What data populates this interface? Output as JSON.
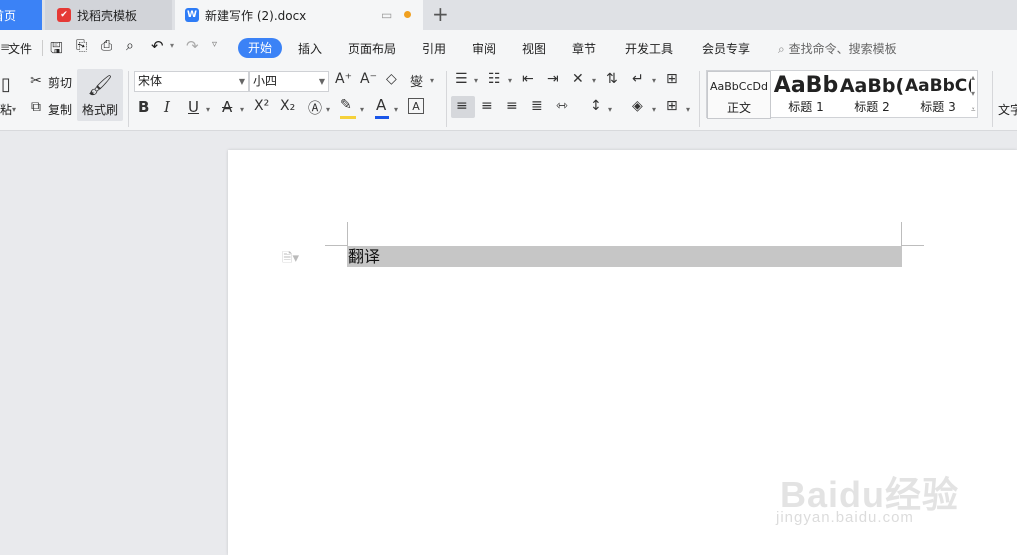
{
  "tabs": {
    "home": "首页",
    "template": "找稻壳模板",
    "document": "新建写作 (2).docx",
    "new_tab_icon": "plus-icon"
  },
  "menu": {
    "file": "文件",
    "items": [
      "开始",
      "插入",
      "页面布局",
      "引用",
      "审阅",
      "视图",
      "章节",
      "开发工具",
      "会员专享"
    ],
    "active": "开始",
    "search_placeholder": "查找命令、搜索模板"
  },
  "ribbon": {
    "clipboard": {
      "paste": "粘",
      "cut": "剪切",
      "copy": "复制",
      "format_painter": "格式刷"
    },
    "font": {
      "name": "宋体",
      "size": "小四"
    },
    "styles": [
      {
        "preview": "AaBbCcDd",
        "name": "正文"
      },
      {
        "preview": "AaBb",
        "name": "标题 1"
      },
      {
        "preview": "AaBb(",
        "name": "标题 2"
      },
      {
        "preview": "AaBbC(",
        "name": "标题 3"
      }
    ],
    "text_tool": "文字"
  },
  "document": {
    "text": "翻译"
  },
  "watermark": {
    "logo": "Baidu经验",
    "url": "jingyan.baidu.com"
  },
  "colors": {
    "accent": "#3b82f6",
    "selection": "#c6c6c6",
    "font_color_underline": "#1a56e8",
    "highlight": "#f5d13b"
  }
}
